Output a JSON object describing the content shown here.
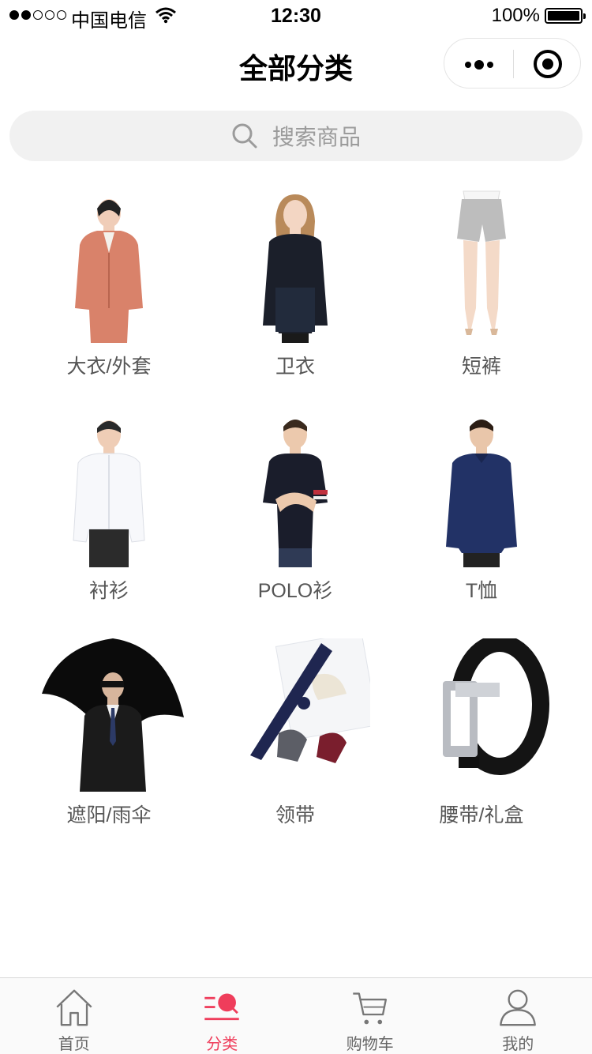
{
  "status_bar": {
    "carrier": "中国电信",
    "time": "12:30",
    "battery": "100%"
  },
  "nav": {
    "title": "全部分类"
  },
  "search": {
    "placeholder": "搜索商品",
    "icon": "search-icon"
  },
  "categories": [
    {
      "label": "大衣/外套",
      "thumb": "blazer-woman"
    },
    {
      "label": "卫衣",
      "thumb": "sweatshirt-woman"
    },
    {
      "label": "短裤",
      "thumb": "shorts"
    },
    {
      "label": "衬衫",
      "thumb": "shirt-man"
    },
    {
      "label": "POLO衫",
      "thumb": "polo-man"
    },
    {
      "label": "T恤",
      "thumb": "tshirt-man"
    },
    {
      "label": "遮阳/雨伞",
      "thumb": "umbrella-man"
    },
    {
      "label": "领带",
      "thumb": "ties"
    },
    {
      "label": "腰带/礼盒",
      "thumb": "belt"
    }
  ],
  "tabbar": {
    "items": [
      {
        "label": "首页",
        "icon": "home-icon"
      },
      {
        "label": "分类",
        "icon": "category-icon",
        "active": true
      },
      {
        "label": "购物车",
        "icon": "cart-icon"
      },
      {
        "label": "我的",
        "icon": "profile-icon"
      }
    ],
    "active_color": "#ef3d5b"
  }
}
